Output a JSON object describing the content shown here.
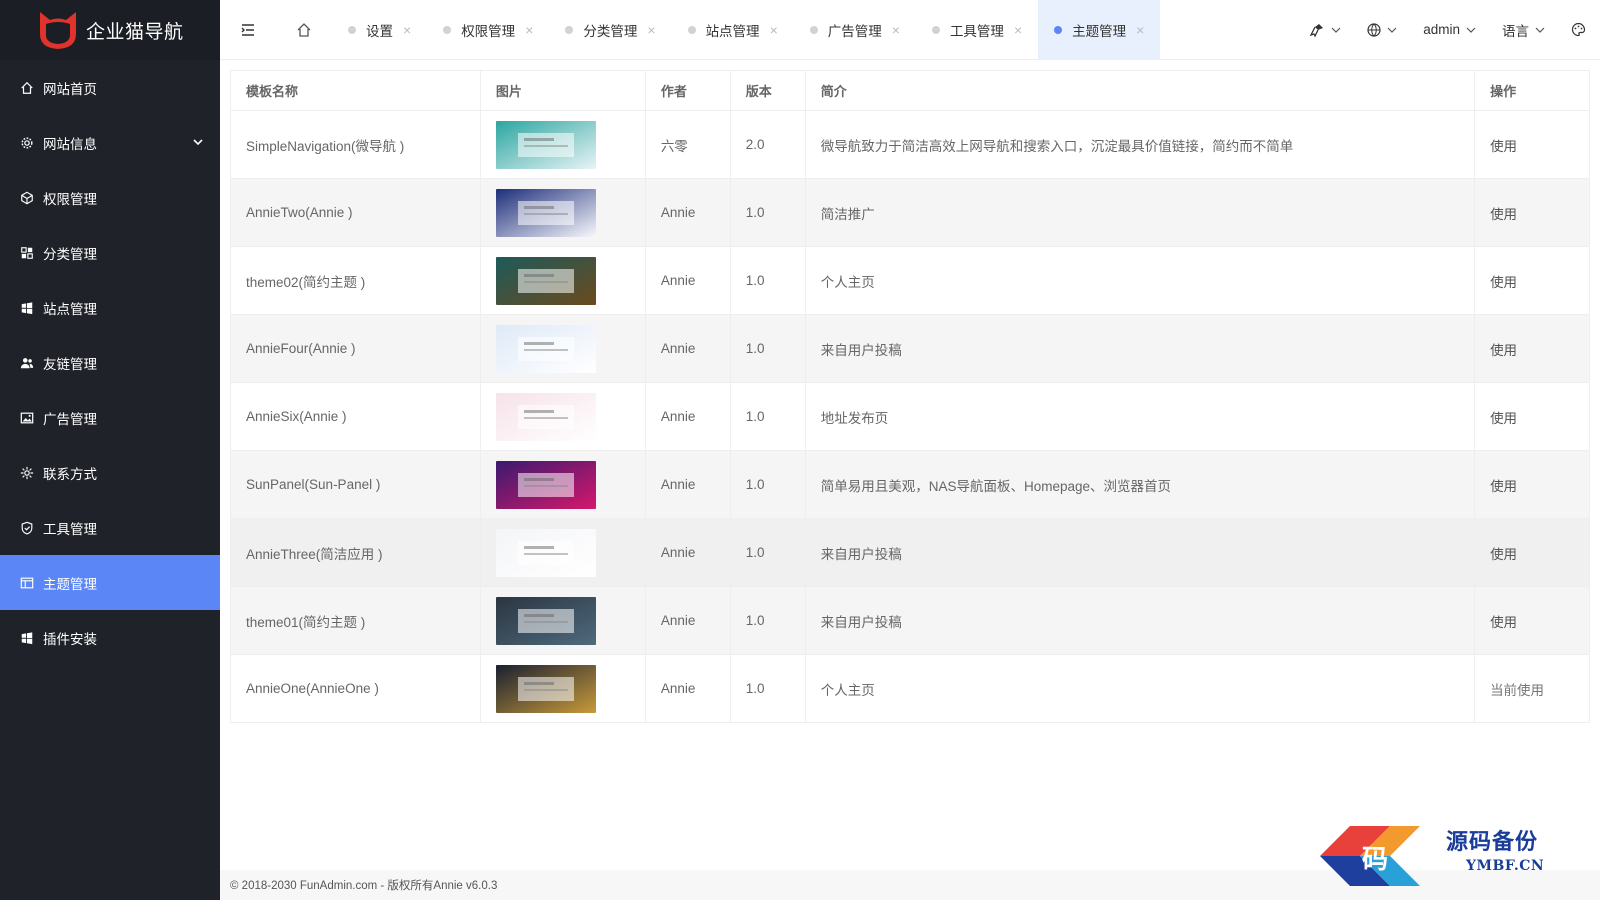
{
  "app": {
    "logo_text": "企业猫导航",
    "accent": "#5b86f5",
    "sidebar_bg": "#20222a"
  },
  "sidebar": {
    "items": [
      {
        "label": "网站首页",
        "icon": "home-icon"
      },
      {
        "label": "网站信息",
        "icon": "gear-icon",
        "has_children": true
      },
      {
        "label": "权限管理",
        "icon": "cube-icon"
      },
      {
        "label": "分类管理",
        "icon": "apps-icon"
      },
      {
        "label": "站点管理",
        "icon": "windows-icon"
      },
      {
        "label": "友链管理",
        "icon": "users-icon"
      },
      {
        "label": "广告管理",
        "icon": "image-icon"
      },
      {
        "label": "联系方式",
        "icon": "sun-icon"
      },
      {
        "label": "工具管理",
        "icon": "shield-check-icon"
      },
      {
        "label": "主题管理",
        "icon": "layout-icon",
        "active": true
      },
      {
        "label": "插件安装",
        "icon": "windows-icon"
      }
    ]
  },
  "topbar": {
    "tabs": [
      {
        "label": "设置"
      },
      {
        "label": "权限管理"
      },
      {
        "label": "分类管理"
      },
      {
        "label": "站点管理"
      },
      {
        "label": "广告管理"
      },
      {
        "label": "工具管理"
      },
      {
        "label": "主题管理",
        "active": true
      }
    ],
    "close_glyph": "×",
    "user": "admin",
    "language": "语言"
  },
  "table": {
    "headers": [
      "模板名称",
      "图片",
      "作者",
      "版本",
      "简介",
      "操作"
    ],
    "rows": [
      {
        "name": "SimpleNavigation(微导航 )",
        "author": "六零",
        "version": "2.0",
        "desc": "微导航致力于简洁高效上网导航和搜索入口，沉淀最具价值链接，简约而不简单",
        "action": "使用",
        "thumb_colors": [
          "#2ba6a0",
          "#e9f3f6"
        ]
      },
      {
        "name": "AnnieTwo(Annie )",
        "author": "Annie",
        "version": "1.0",
        "desc": "简洁推广",
        "action": "使用",
        "thumb_colors": [
          "#1d2e7a",
          "#f7f8fc"
        ]
      },
      {
        "name": "theme02(简约主题 )",
        "author": "Annie",
        "version": "1.0",
        "desc": "个人主页",
        "action": "使用",
        "thumb_colors": [
          "#1d5a5a",
          "#6b4a1e"
        ]
      },
      {
        "name": "AnnieFour(Annie )",
        "author": "Annie",
        "version": "1.0",
        "desc": "来自用户投稿",
        "action": "使用",
        "thumb_colors": [
          "#dfe9f7",
          "#ffffff"
        ]
      },
      {
        "name": "AnnieSix(Annie )",
        "author": "Annie",
        "version": "1.0",
        "desc": "地址发布页",
        "action": "使用",
        "thumb_colors": [
          "#f6e2ea",
          "#ffffff"
        ]
      },
      {
        "name": "SunPanel(Sun-Panel )",
        "author": "Annie",
        "version": "1.0",
        "desc": "简单易用且美观，NAS导航面板、Homepage、浏览器首页",
        "action": "使用",
        "thumb_colors": [
          "#3a1a6e",
          "#d6186c"
        ]
      },
      {
        "name": "AnnieThree(简洁应用 )",
        "author": "Annie",
        "version": "1.0",
        "desc": "来自用户投稿",
        "action": "使用",
        "thumb_colors": [
          "#f4f5f8",
          "#ffffff"
        ]
      },
      {
        "name": "theme01(简约主题 )",
        "author": "Annie",
        "version": "1.0",
        "desc": "来自用户投稿",
        "action": "使用",
        "thumb_colors": [
          "#2b3542",
          "#4e6a7c"
        ]
      },
      {
        "name": "AnnieOne(AnnieOne )",
        "author": "Annie",
        "version": "1.0",
        "desc": "个人主页",
        "action": "当前使用",
        "thumb_colors": [
          "#1a2030",
          "#c89a3a"
        ]
      }
    ]
  },
  "footer": {
    "text": "© 2018-2030 FunAdmin.com - 版权所有Annie v6.0.3"
  },
  "watermark": {
    "title": "源码备份",
    "domain": "YMBF.CN",
    "logo_char": "码"
  }
}
